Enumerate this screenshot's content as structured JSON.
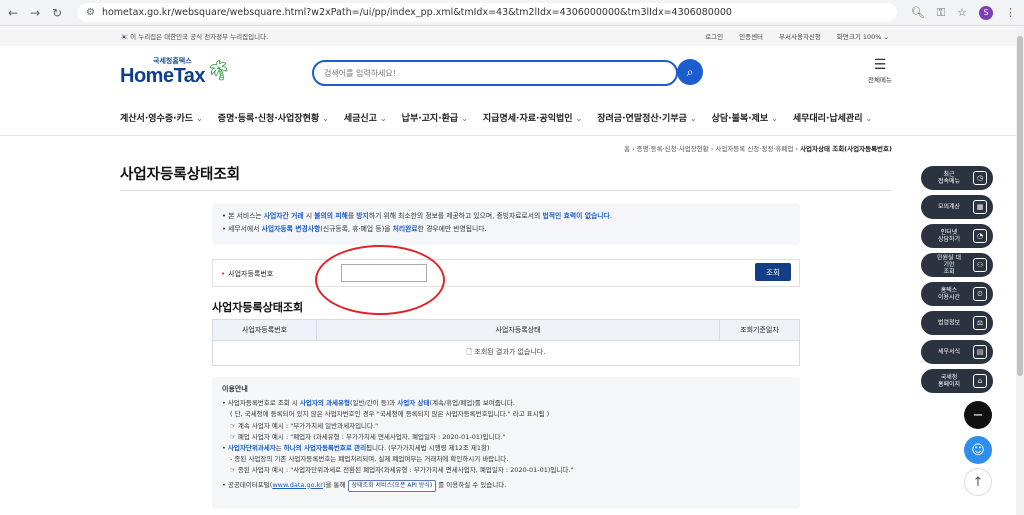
{
  "browser": {
    "url": "hometax.go.kr/websquare/websquare.html?w2xPath=/ui/pp/index_pp.xml&tmIdx=43&tm2lIdx=4306000000&tm3lIdx=4306080000",
    "profile_initial": "S"
  },
  "topstrip": {
    "gov_notice": "이 누리집은 대한민국 공식 전자정부 누리집입니다.",
    "links": [
      "로그인",
      "인증센터",
      "부서사용자신청",
      "화면크기 100% ⌄"
    ]
  },
  "header": {
    "logo_tag": "국세청홈택스",
    "logo_name": "HomeTax",
    "search_placeholder": "검색어를 입력하세요!",
    "all_menu_label": "전체메뉴"
  },
  "gnb": [
    "계산서·영수증·카드",
    "증명·등록·신청·사업장현황",
    "세금신고",
    "납부·고지·환급",
    "지급명세·자료·공익법인",
    "장려금·연말정산·기부금",
    "상담·불복·제보",
    "세무대리·납세관리"
  ],
  "breadcrumb": {
    "path": "홈 › 증명·등록·신청·사업장현황 › 사업자등록 신청·정정·휴폐업 › ",
    "current": "사업자상태 조회(사업자등록번호)"
  },
  "page_title": "사업자등록상태조회",
  "notice": {
    "l1a": "본 서비스는 ",
    "l1b": "사업자간 거래",
    "l1c": " 시 ",
    "l1d": "불의의 피해",
    "l1e": "를 ",
    "l1f": "방지",
    "l1g": "하기 위해 최소한의 정보를 제공하고 있으며, 증빙자료로서의 ",
    "l1h": "법적인 효력이 없습니다",
    "l2a": "세무서에서 ",
    "l2b": "사업자등록 변경사항",
    "l2c": "(신규등록, 휴·폐업 등)을 ",
    "l2d": "처리완료",
    "l2e": "한 경우에만 반영됩니다."
  },
  "form": {
    "label": "사업자등록번호",
    "value": "",
    "button": "조회"
  },
  "result": {
    "subtitle": "사업자등록상태조회",
    "columns": [
      "사업자등록번호",
      "사업자등록상태",
      "조회기준일자"
    ],
    "empty_message": "조회된 결과가 없습니다."
  },
  "info": {
    "heading": "이용안내",
    "l1a": "사업자등록번호로 조회 시 ",
    "l1b": "사업자의 과세유형",
    "l1c": "(일반/간이 등)과 ",
    "l1d": "사업자 상태",
    "l1e": "(계속/휴업/폐업)를 보여줍니다.",
    "l2": "( 단, 국세청에 등록되어 있지 않은 사업자번호인 경우 \"국세청에 등록되지 않은 사업자등록번호입니다.\" 라고 표시됨 )",
    "l3": "☞ 계속 사업자 예시 : \"부가가치세 일반과세자입니다.\"",
    "l4": "☞ 폐업 사업자 예시 : \"폐업자 (과세유형 : 부가가치세 면세사업자, 폐업일자 : 2020-01-01)입니다.\"",
    "l5a": "사업자단위과세자",
    "l5b": "는 ",
    "l5c": "하나의 사업자등록번호로 관리",
    "l5d": "됩니다. (부가가치세법 시행령 제12조 제1항)",
    "l6": "- 종된 사업장의 기존 사업자등록번호는 폐업처리되며, 실제 폐업여부는 거래처에 확인하시기 바랍니다.",
    "l7": "☞ 종된 사업자 예시 : \"사업자단위과세로 전환된 폐업자(과세유형 : 부가가치세 면세사업자, 폐업일자 : 2020-01-01)입니다.\"",
    "l8a": "공공데이터포털(",
    "l8b": "www.data.go.kr",
    "l8c": ")을 통해 ",
    "l8d": "상태조회 서비스(오픈 API 방식)",
    "l8e": " 를 이용하실 수 있습니다."
  },
  "quick_menu": [
    {
      "label": "최근\n접속메뉴",
      "icon": "clock-icon"
    },
    {
      "label": "모의계산",
      "icon": "calculator-icon"
    },
    {
      "label": "인터넷\n상담하기",
      "icon": "chat-icon"
    },
    {
      "label": "민원실 대기인\n조회",
      "icon": "people-icon"
    },
    {
      "label": "홈택스\n이용시간",
      "icon": "alarm-icon"
    },
    {
      "label": "법령정보",
      "icon": "scale-icon"
    },
    {
      "label": "세무서식",
      "icon": "document-icon"
    },
    {
      "label": "국세청\n홈페이지",
      "icon": "building-icon"
    }
  ]
}
